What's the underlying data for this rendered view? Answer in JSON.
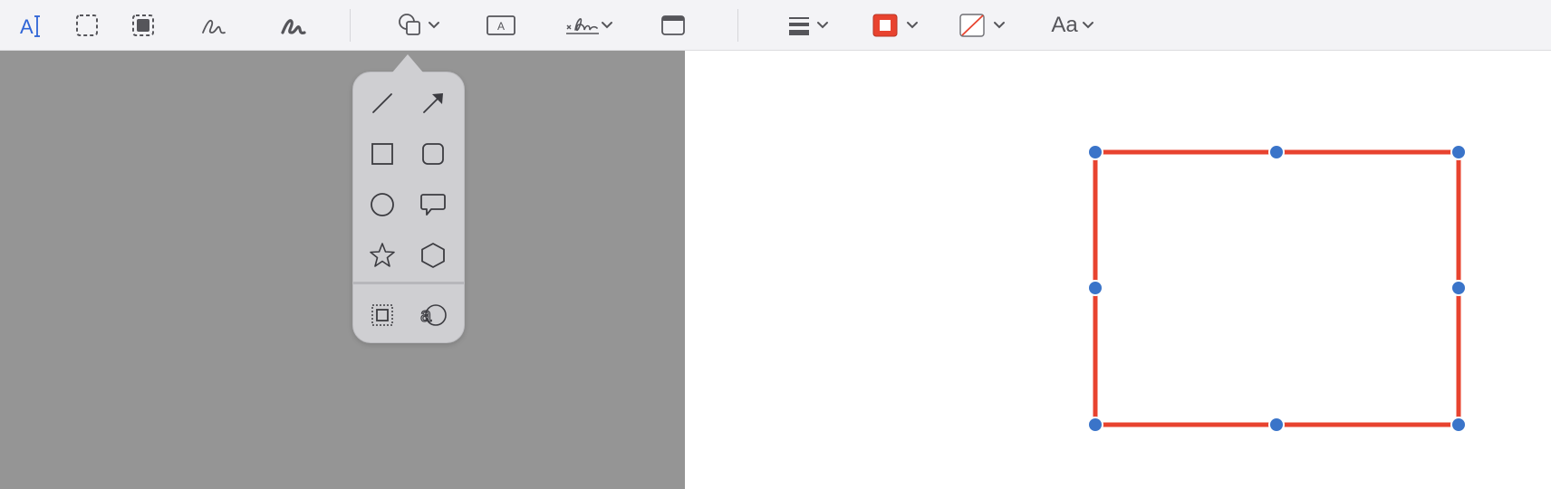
{
  "toolbar": {
    "text_selection_icon": "text-selection-icon",
    "font_button_label": "Aa",
    "tools": [
      {
        "name": "text-selection-tool",
        "icon": "text-cursor-icon"
      },
      {
        "name": "rectangular-selection-tool",
        "icon": "dashed-rectangle-icon"
      },
      {
        "name": "smart-lasso-tool",
        "icon": "dashed-filled-rectangle-icon"
      },
      {
        "name": "sketch-tool",
        "icon": "sketch-squiggle-icon"
      },
      {
        "name": "draw-tool",
        "icon": "draw-squiggle-icon"
      },
      {
        "name": "shapes-tool",
        "icon": "shapes-icon"
      },
      {
        "name": "text-box-tool",
        "icon": "text-box-icon"
      },
      {
        "name": "signature-tool",
        "icon": "signature-icon"
      },
      {
        "name": "window-tool",
        "icon": "window-icon"
      },
      {
        "name": "shape-style-tool",
        "icon": "line-weight-icon"
      },
      {
        "name": "border-color-tool",
        "icon": "border-color-icon"
      },
      {
        "name": "fill-color-tool",
        "icon": "fill-color-none-icon"
      },
      {
        "name": "text-style-tool",
        "icon": "text-style-icon"
      }
    ]
  },
  "popover": {
    "shapes": [
      "line-icon",
      "arrow-icon",
      "rectangle-icon",
      "rounded-rectangle-icon",
      "oval-icon",
      "speech-bubble-icon",
      "star-icon",
      "polygon-icon",
      "mask-icon",
      "loupe-icon"
    ]
  },
  "colors": {
    "accent_blue": "#3a74c9",
    "annotation_red": "#e8432f",
    "toolbar_bg": "#f3f3f6",
    "sidebar_gray": "#959595",
    "popover_bg": "#cfcfd2",
    "icon_gray": "#55555a"
  }
}
